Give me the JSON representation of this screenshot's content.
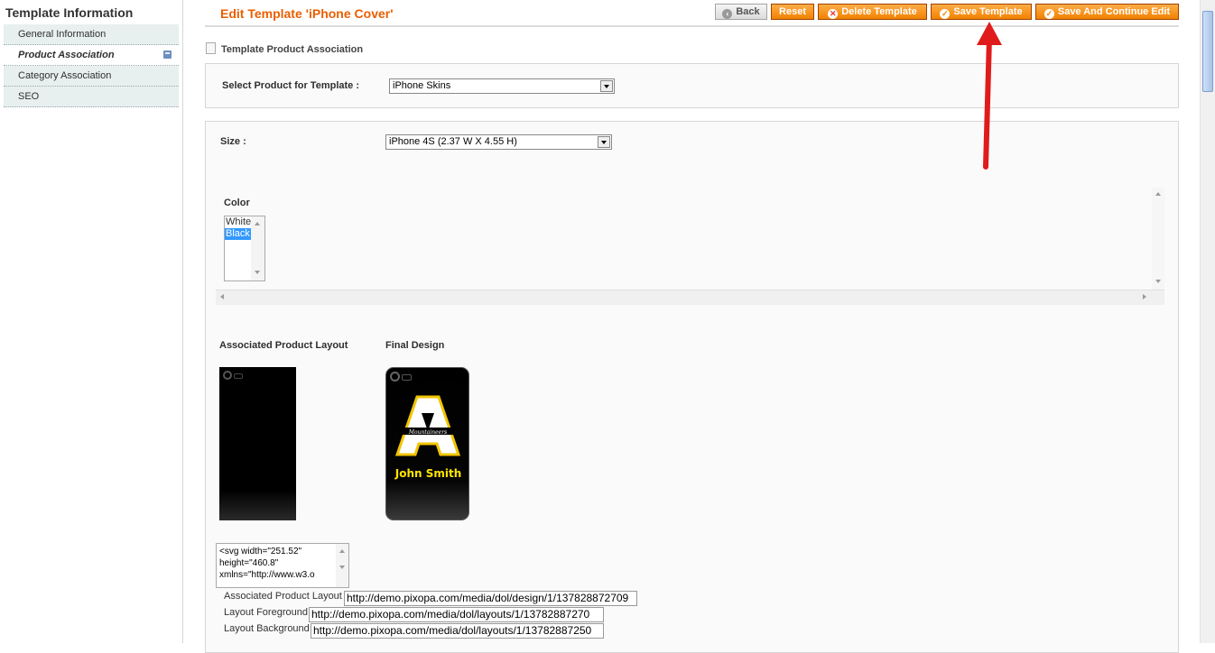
{
  "sidebar": {
    "title": "Template Information",
    "items": [
      {
        "label": "General Information"
      },
      {
        "label": "Product Association"
      },
      {
        "label": "Category Association"
      },
      {
        "label": "SEO"
      }
    ]
  },
  "header": {
    "title": "Edit Template 'iPhone Cover'",
    "buttons": {
      "back": "Back",
      "reset": "Reset",
      "delete": "Delete Template",
      "save": "Save Template",
      "save_continue": "Save And Continue Edit"
    }
  },
  "section": {
    "title": "Template Product Association"
  },
  "product": {
    "label": "Select Product for Template :",
    "selected": "iPhone Skins"
  },
  "size": {
    "label": "Size :",
    "selected": "iPhone 4S (2.37 W X 4.55 H)"
  },
  "color": {
    "label": "Color",
    "options": [
      "White",
      "Black"
    ],
    "selected": "Black"
  },
  "layout": {
    "associated_title": "Associated Product Layout",
    "final_title": "Final Design",
    "design_letter": "A",
    "design_banner": "Mountaineers",
    "design_name": "John Smith"
  },
  "svg_source": {
    "lines": [
      "<svg width=\"251.52\"",
      "height=\"460.8\"",
      "xmlns=\"http://www.w3.o"
    ]
  },
  "fields": {
    "associated_layout": {
      "label": "Associated Product Layout",
      "value": "http://demo.pixopa.com/media/dol/design/1/137828872709"
    },
    "foreground": {
      "label": "Layout Foreground",
      "value": "http://demo.pixopa.com/media/dol/layouts/1/13782887270"
    },
    "background": {
      "label": "Layout Background",
      "value": "http://demo.pixopa.com/media/dol/layouts/1/13782887250"
    }
  },
  "colors": {
    "accent": "#eb5e00",
    "button": "#f18200",
    "annotation_arrow": "#e01b1b",
    "selected_option": "#3399ff"
  }
}
